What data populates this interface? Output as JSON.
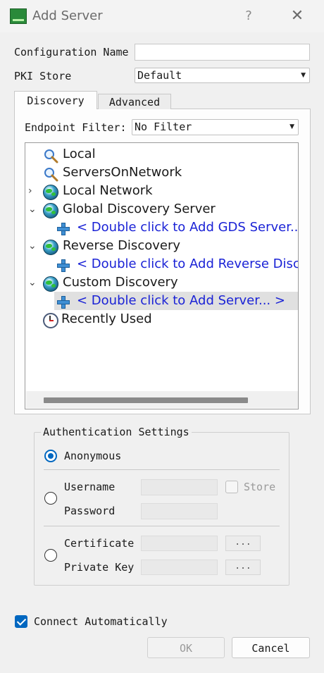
{
  "window": {
    "title": "Add Server",
    "help_label": "?",
    "close_label": "✕"
  },
  "form": {
    "config_name_label": "Configuration Name",
    "config_name_value": "",
    "pki_store_label": "PKI Store",
    "pki_store_value": "Default"
  },
  "tabs": [
    {
      "label": "Discovery",
      "active": true
    },
    {
      "label": "Advanced",
      "active": false
    }
  ],
  "discovery": {
    "endpoint_filter_label": "Endpoint Filter:",
    "endpoint_filter_value": "No Filter",
    "tree": [
      {
        "label": "Local",
        "icon": "search-icon",
        "expander": ""
      },
      {
        "label": "ServersOnNetwork",
        "icon": "search-icon",
        "expander": ""
      },
      {
        "label": "Local Network",
        "icon": "globe-icon",
        "expander": "›"
      },
      {
        "label": "Global Discovery Server",
        "icon": "globe-icon",
        "expander": "⌄"
      },
      {
        "label": "< Double click to Add GDS Server... >",
        "icon": "plus-icon",
        "expander": ""
      },
      {
        "label": "Reverse Discovery",
        "icon": "globe-icon",
        "expander": "⌄"
      },
      {
        "label": "< Double click to Add Reverse Discovery >",
        "icon": "plus-icon",
        "expander": ""
      },
      {
        "label": "Custom Discovery",
        "icon": "globe-icon",
        "expander": "⌄"
      },
      {
        "label": "< Double click to Add Server... >",
        "icon": "plus-icon",
        "expander": "",
        "selected": true
      },
      {
        "label": "Recently Used",
        "icon": "clock-icon",
        "expander": ""
      }
    ]
  },
  "auth": {
    "title": "Authentication Settings",
    "anonymous_label": "Anonymous",
    "username_label": "Username",
    "password_label": "Password",
    "store_label": "Store",
    "certificate_label": "Certificate",
    "private_key_label": "Private Key",
    "browse_label": "...",
    "selected": "anonymous"
  },
  "connect_automatically": {
    "label": "Connect Automatically",
    "checked": true
  },
  "buttons": {
    "ok": "OK",
    "cancel": "Cancel"
  },
  "colors": {
    "accent": "#0067c0",
    "link": "#1a22d6"
  }
}
